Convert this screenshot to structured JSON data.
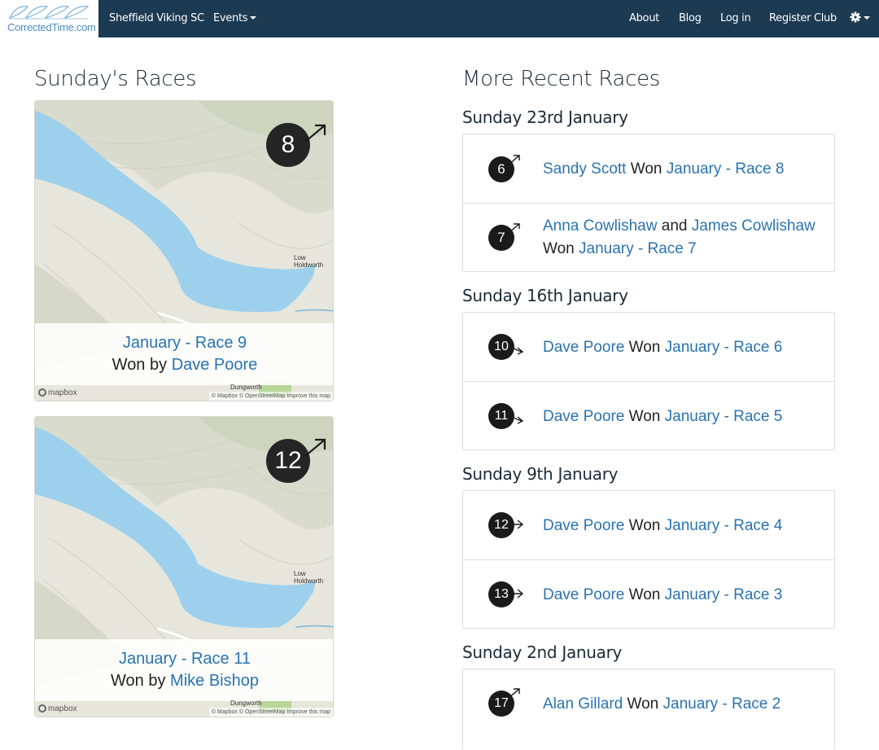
{
  "brand": {
    "name": "CorrectedTime.com"
  },
  "nav": {
    "club": "Sheffield Viking SC",
    "events": "Events",
    "about": "About",
    "blog": "Blog",
    "login": "Log in",
    "register": "Register Club",
    "settings_icon": "gear-icon"
  },
  "sundays_races": {
    "title": "Sunday's Races",
    "cards": [
      {
        "race_link": "January - Race 9",
        "won_by_prefix": "Won by",
        "winner": "Dave Poore",
        "wind": "8",
        "places": [
          "Low Holdworth",
          "Dungworth"
        ],
        "attribution": "© Mapbox © OpenStreetMap Improve this map",
        "map_logo": "mapbox"
      },
      {
        "race_link": "January - Race 11",
        "won_by_prefix": "Won by",
        "winner": "Mike Bishop",
        "wind": "12",
        "places": [
          "Low Holdworth",
          "Dungworth"
        ],
        "attribution": "© Mapbox © OpenStreetMap Improve this map",
        "map_logo": "mapbox"
      }
    ]
  },
  "recent_races": {
    "title": "More Recent Races",
    "won_word": "Won",
    "and_word": "and",
    "groups": [
      {
        "date": "Sunday 23rd January",
        "races": [
          {
            "wind": "6",
            "winner": "Sandy Scott",
            "race": "January - Race 8"
          },
          {
            "wind": "7",
            "winner": "Anna Cowlishaw",
            "winner2": "James Cowlishaw",
            "race": "January - Race 7"
          }
        ]
      },
      {
        "date": "Sunday 16th January",
        "races": [
          {
            "wind": "10",
            "winner": "Dave Poore",
            "race": "January - Race 6"
          },
          {
            "wind": "11",
            "winner": "Dave Poore",
            "race": "January - Race 5"
          }
        ]
      },
      {
        "date": "Sunday 9th January",
        "races": [
          {
            "wind": "12",
            "winner": "Dave Poore",
            "race": "January - Race 4"
          },
          {
            "wind": "13",
            "winner": "Dave Poore",
            "race": "January - Race 3"
          }
        ]
      },
      {
        "date": "Sunday 2nd January",
        "races": [
          {
            "wind": "17",
            "winner": "Alan Gillard",
            "race": "January - Race 2"
          }
        ]
      }
    ]
  }
}
